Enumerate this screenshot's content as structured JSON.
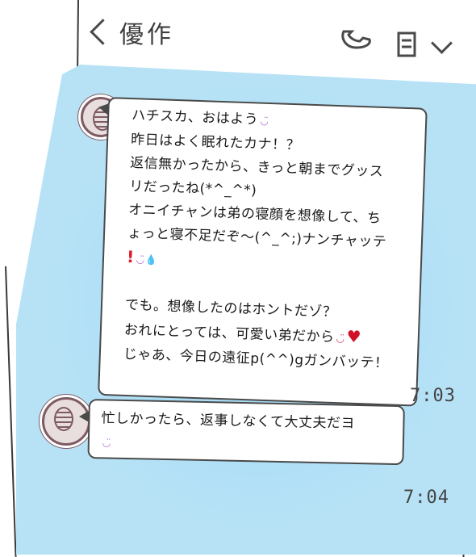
{
  "header": {
    "title": "優作",
    "icons": [
      "back-icon",
      "phone-icon",
      "book-icon",
      "chevron-down-icon"
    ]
  },
  "messages": [
    {
      "lines": [
        "ハチスカ、おはよう",
        "昨日はよく眠れたカナ！？",
        "返信無かったから、きっと朝までグッス",
        "リだったね(*^_^*)",
        "オニイチャンは弟の寝顔を想像して、ち",
        "ょっと寝不足だぞ〜(^_^;)ナンチャッテ",
        "",
        "でも。想像したのはホントだゾ？",
        "おれにとっては、可愛い弟だから",
        "じゃあ、今日の遠征p(^^)gガンバッテ！"
      ],
      "time": "7:03"
    },
    {
      "lines": [
        "忙しかったら、返事しなくて大丈夫だヨ"
      ],
      "time": "7:04"
    }
  ],
  "colors": {
    "chat_background": "#b7e2f6",
    "heart": "#d01028",
    "emoji": "#b060d0"
  }
}
